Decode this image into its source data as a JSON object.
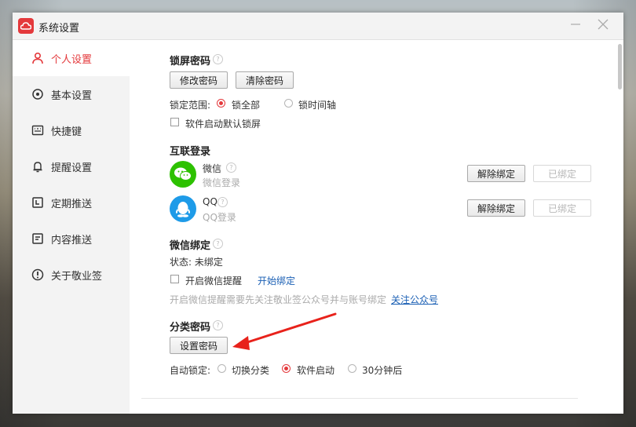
{
  "window": {
    "title": "系统设置"
  },
  "sidebar": {
    "items": [
      {
        "label": "个人设置",
        "icon": "person-icon",
        "active": true
      },
      {
        "label": "基本设置",
        "icon": "gear-icon",
        "active": false
      },
      {
        "label": "快捷键",
        "icon": "keyboard-icon",
        "active": false
      },
      {
        "label": "提醒设置",
        "icon": "bell-icon",
        "active": false
      },
      {
        "label": "定期推送",
        "icon": "calendar-icon",
        "active": false
      },
      {
        "label": "内容推送",
        "icon": "document-icon",
        "active": false
      },
      {
        "label": "关于敬业签",
        "icon": "info-icon",
        "active": false
      }
    ]
  },
  "lock": {
    "title": "锁屏密码",
    "change_btn": "修改密码",
    "clear_btn": "清除密码",
    "scope_label": "锁定范围:",
    "scope_all": "锁全部",
    "scope_timeline": "锁时间轴",
    "startup_lock": "软件启动默认锁屏"
  },
  "login": {
    "title": "互联登录",
    "wechat": {
      "name": "微信",
      "sub": "微信登录",
      "unbind": "解除绑定",
      "status": "已绑定"
    },
    "qq": {
      "name": "QQ",
      "sub": "QQ登录",
      "unbind": "解除绑定",
      "status": "已绑定"
    }
  },
  "wx_bind": {
    "title": "微信绑定",
    "status": "状态: 未绑定",
    "enable_reminder": "开启微信提醒",
    "start_bind": "开始绑定",
    "note": "开启微信提醒需要先关注敬业签公众号并与账号绑定",
    "follow_link": "关注公众号"
  },
  "category": {
    "title": "分类密码",
    "set_btn": "设置密码",
    "auto_lock_label": "自动锁定:",
    "opt_switch": "切换分类",
    "opt_startup": "软件启动",
    "opt_30min": "30分钟后"
  },
  "colors": {
    "accent": "#e4393c",
    "link": "#1a5fb4",
    "wechat": "#2dc100",
    "qq": "#1e9be8"
  }
}
